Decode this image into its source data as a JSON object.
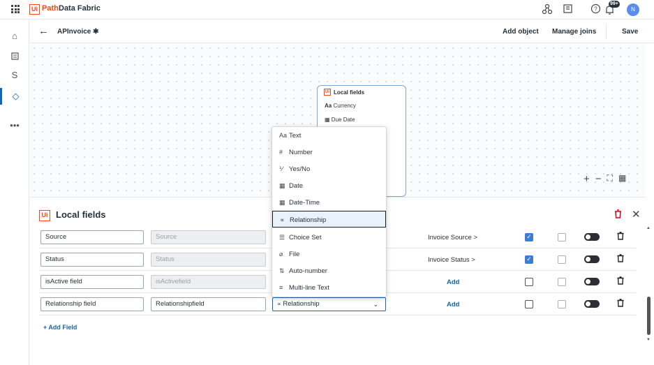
{
  "app": {
    "logo_box": "Ui",
    "logo_path": "Path",
    "title": "Data Fabric",
    "notification_count": "99+",
    "avatar_initial": "N"
  },
  "header": {
    "entity_name": "APInvoice",
    "add_object": "Add object",
    "manage_joins": "Manage joins",
    "save": "Save"
  },
  "node": {
    "title": "Local fields",
    "fields": [
      {
        "icon": "Aa",
        "label": "Currency"
      },
      {
        "icon": "cal",
        "label": "Due Date"
      }
    ]
  },
  "panel": {
    "logo": "Ui",
    "title": "Local fields",
    "add_field": "+ Add Field",
    "rows": [
      {
        "display_name": "Source",
        "name": "Source",
        "relation": "Invoice Source >",
        "required": true
      },
      {
        "display_name": "Status",
        "name": "Status",
        "relation": "Invoice Status >",
        "required": true
      },
      {
        "display_name": "isActive field",
        "name": "isActivefield",
        "relation": "Add",
        "required": false
      },
      {
        "display_name": "Relationship field",
        "name": "Relationshipfield",
        "type": "Relationship",
        "relation": "Add",
        "required": false
      }
    ]
  },
  "dropdown": {
    "options": [
      {
        "icon": "Aa",
        "label": "Text"
      },
      {
        "icon": "#",
        "label": "Number"
      },
      {
        "icon": "y/n",
        "label": "Yes/No"
      },
      {
        "icon": "cal",
        "label": "Date"
      },
      {
        "icon": "cal",
        "label": "Date-Time"
      },
      {
        "icon": "rel",
        "label": "Relationship",
        "selected": true
      },
      {
        "icon": "list",
        "label": "Choice Set"
      },
      {
        "icon": "clip",
        "label": "File"
      },
      {
        "icon": "sort",
        "label": "Auto-number"
      },
      {
        "icon": "lines",
        "label": "Multi-line Text"
      }
    ]
  },
  "colors": {
    "brand": "#fa4616",
    "accent": "#1665b3",
    "checkbox_on": "#3b7dd8",
    "delete": "#d0021b"
  }
}
